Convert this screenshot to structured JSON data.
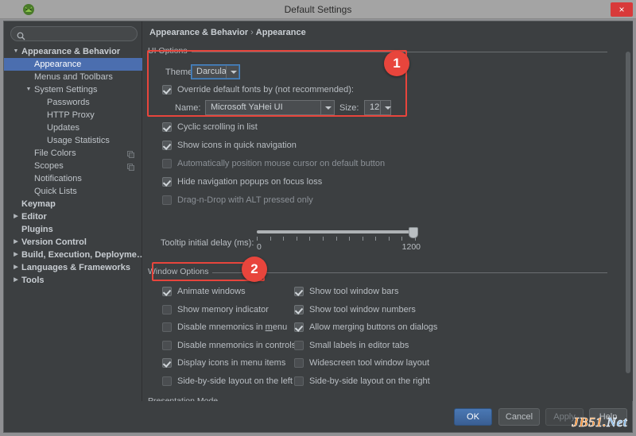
{
  "window": {
    "title": "Default Settings",
    "app_icon": "android-studio-icon",
    "close_label": "×"
  },
  "sidebar": {
    "search": {
      "value": "",
      "placeholder": "",
      "icon": "search-icon"
    },
    "items": [
      {
        "label": "Appearance & Behavior",
        "indent": 0,
        "twisty": "expanded",
        "bold": true,
        "selected": false,
        "icon": null
      },
      {
        "label": "Appearance",
        "indent": 1,
        "twisty": "none",
        "bold": false,
        "selected": true,
        "icon": null
      },
      {
        "label": "Menus and Toolbars",
        "indent": 1,
        "twisty": "none",
        "bold": false,
        "selected": false,
        "icon": null
      },
      {
        "label": "System Settings",
        "indent": 1,
        "twisty": "expanded",
        "bold": false,
        "selected": false,
        "icon": null
      },
      {
        "label": "Passwords",
        "indent": 2,
        "twisty": "none",
        "bold": false,
        "selected": false,
        "icon": null
      },
      {
        "label": "HTTP Proxy",
        "indent": 2,
        "twisty": "none",
        "bold": false,
        "selected": false,
        "icon": null
      },
      {
        "label": "Updates",
        "indent": 2,
        "twisty": "none",
        "bold": false,
        "selected": false,
        "icon": null
      },
      {
        "label": "Usage Statistics",
        "indent": 2,
        "twisty": "none",
        "bold": false,
        "selected": false,
        "icon": null
      },
      {
        "label": "File Colors",
        "indent": 1,
        "twisty": "none",
        "bold": false,
        "selected": false,
        "icon": "copy-icon"
      },
      {
        "label": "Scopes",
        "indent": 1,
        "twisty": "none",
        "bold": false,
        "selected": false,
        "icon": "copy-icon"
      },
      {
        "label": "Notifications",
        "indent": 1,
        "twisty": "none",
        "bold": false,
        "selected": false,
        "icon": null
      },
      {
        "label": "Quick Lists",
        "indent": 1,
        "twisty": "none",
        "bold": false,
        "selected": false,
        "icon": null
      },
      {
        "label": "Keymap",
        "indent": 0,
        "twisty": "none",
        "bold": true,
        "selected": false,
        "icon": null
      },
      {
        "label": "Editor",
        "indent": 0,
        "twisty": "collapsed",
        "bold": true,
        "selected": false,
        "icon": null
      },
      {
        "label": "Plugins",
        "indent": 0,
        "twisty": "none",
        "bold": true,
        "selected": false,
        "icon": null
      },
      {
        "label": "Version Control",
        "indent": 0,
        "twisty": "collapsed",
        "bold": true,
        "selected": false,
        "icon": null
      },
      {
        "label": "Build, Execution, Deployme…",
        "indent": 0,
        "twisty": "collapsed",
        "bold": true,
        "selected": false,
        "icon": null
      },
      {
        "label": "Languages & Frameworks",
        "indent": 0,
        "twisty": "collapsed",
        "bold": true,
        "selected": false,
        "icon": null
      },
      {
        "label": "Tools",
        "indent": 0,
        "twisty": "collapsed",
        "bold": true,
        "selected": false,
        "icon": null
      }
    ]
  },
  "breadcrumb": {
    "parent": "Appearance & Behavior",
    "separator": "›",
    "current": "Appearance"
  },
  "ui_options": {
    "group_label": "UI Options",
    "theme_label": "Theme:",
    "theme_value": "Darcula",
    "override_fonts": {
      "label": "Override default fonts by (not recommended):",
      "checked": true
    },
    "name_label": "Name:",
    "font_name_value": "Microsoft YaHei UI",
    "size_label": "Size:",
    "font_size_value": "12",
    "checkboxes": [
      {
        "label": "Cyclic scrolling in list",
        "checked": true,
        "enabled": true
      },
      {
        "label": "Show icons in quick navigation",
        "checked": true,
        "enabled": true
      },
      {
        "label": "Automatically position mouse cursor on default button",
        "checked": false,
        "enabled": false
      },
      {
        "label": "Hide navigation popups on focus loss",
        "checked": true,
        "enabled": true
      },
      {
        "label": "Drag-n-Drop with ALT pressed only",
        "checked": false,
        "enabled": false
      }
    ],
    "tooltip_delay": {
      "label": "Tooltip initial delay (ms):",
      "min": "0",
      "max": "1200",
      "value_percent": 99
    }
  },
  "window_options": {
    "group_label": "Window Options",
    "left_column": [
      {
        "label": "Animate windows",
        "checked": true,
        "mnemonic": ""
      },
      {
        "label": "Show memory indicator",
        "checked": false,
        "mnemonic": ""
      },
      {
        "label": "Disable mnemonics in menu",
        "checked": false,
        "mnemonic": "m"
      },
      {
        "label": "Disable mnemonics in controls",
        "checked": false,
        "mnemonic": ""
      },
      {
        "label": "Display icons in menu items",
        "checked": true,
        "mnemonic": ""
      },
      {
        "label": "Side-by-side layout on the left",
        "checked": false,
        "mnemonic": ""
      }
    ],
    "right_column": [
      {
        "label": "Show tool window bars",
        "checked": true
      },
      {
        "label": "Show tool window numbers",
        "checked": true
      },
      {
        "label": "Allow merging buttons on dialogs",
        "checked": true
      },
      {
        "label": "Small labels in editor tabs",
        "checked": false
      },
      {
        "label": "Widescreen tool window layout",
        "checked": false
      },
      {
        "label": "Side-by-side layout on the right",
        "checked": false
      }
    ]
  },
  "presentation_mode": {
    "group_label": "Presentation Mode"
  },
  "annotations": [
    {
      "badge": "1",
      "target": "ui-options-font-block"
    },
    {
      "badge": "2",
      "target": "animate-windows-checkbox"
    }
  ],
  "footer": {
    "ok": "OK",
    "cancel": "Cancel",
    "apply": "Apply",
    "help": "Help"
  },
  "watermark": {
    "part1": "JB51.",
    "part2": "Net"
  },
  "colors": {
    "accent_selection": "#4b6eaf",
    "annotation_red": "#e8453c",
    "panel_bg": "#3c3f41",
    "titlebar_bg": "#a4a4a4",
    "close_red": "#d83a3a"
  }
}
